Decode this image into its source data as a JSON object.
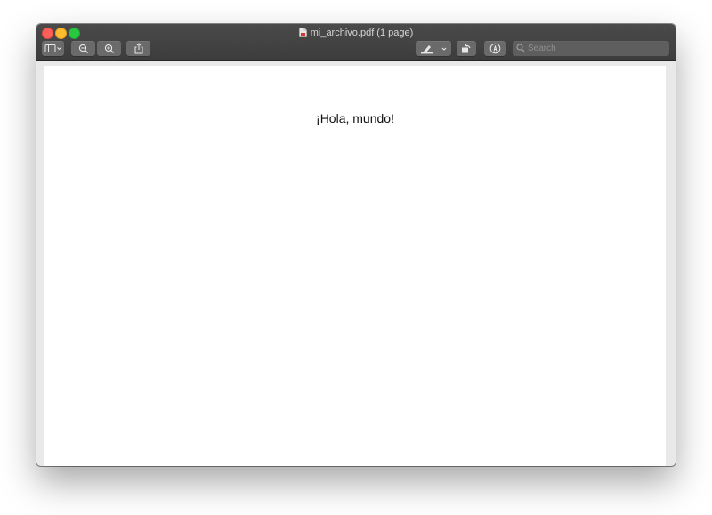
{
  "window": {
    "title": "mi_archivo.pdf (1 page)"
  },
  "toolbar": {
    "search_placeholder": "Search"
  },
  "document": {
    "text": "¡Hola, mundo!"
  },
  "colors": {
    "close": "#fc5f57",
    "minimize": "#fdbc2e",
    "zoom": "#28c840",
    "toolbar": "#3e3e3e"
  },
  "icons": [
    "sidebar-icon",
    "chevron-down-icon",
    "zoom-out-icon",
    "zoom-in-icon",
    "share-icon",
    "highlight-pen-icon",
    "rotate-icon",
    "markup-icon",
    "search-icon",
    "document-icon"
  ]
}
